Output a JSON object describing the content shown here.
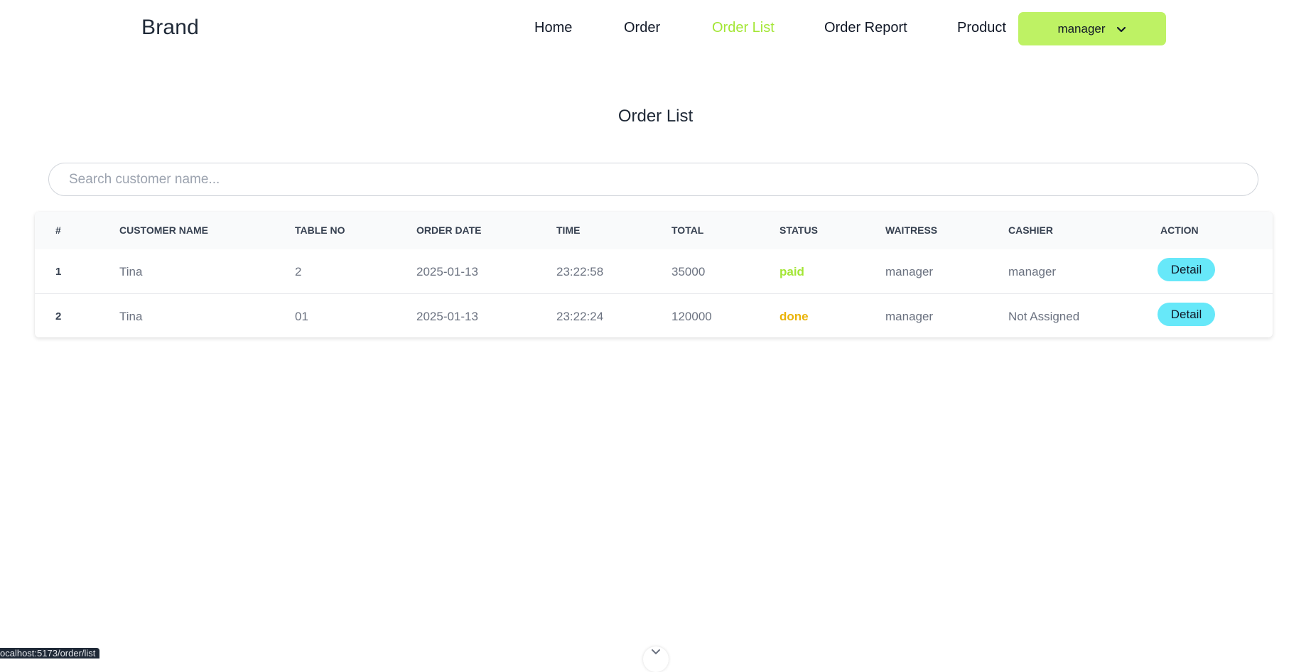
{
  "navbar": {
    "brand": "Brand",
    "links": [
      "Home",
      "Order",
      "Order List",
      "Order Report",
      "Product"
    ],
    "active_link": "Order List",
    "user_menu_label": "manager",
    "accent_color": "#bef264"
  },
  "page": {
    "title": "Order List"
  },
  "search": {
    "placeholder": "Search customer name...",
    "value": ""
  },
  "table": {
    "headers": [
      "#",
      "CUSTOMER NAME",
      "TABLE NO",
      "ORDER DATE",
      "TIME",
      "TOTAL",
      "STATUS",
      "WAITRESS",
      "CASHIER",
      "ACTION"
    ],
    "rows": [
      {
        "no": "1",
        "customer": "Tina",
        "table_no": "2",
        "date": "2025-01-13",
        "time": "23:22:58",
        "total": "35000",
        "status": "paid",
        "waitress": "manager",
        "cashier": "manager",
        "action": "Detail"
      },
      {
        "no": "2",
        "customer": "Tina",
        "table_no": "01",
        "date": "2025-01-13",
        "time": "23:22:24",
        "total": "120000",
        "status": "done",
        "waitress": "manager",
        "cashier": "Not Assigned",
        "action": "Detail"
      }
    ],
    "status_colors": {
      "paid": "#a3e635",
      "done": "#eab308"
    },
    "action_color": "#67e8f9"
  },
  "statusbar": {
    "url": "ocalhost:5173/order/list"
  }
}
